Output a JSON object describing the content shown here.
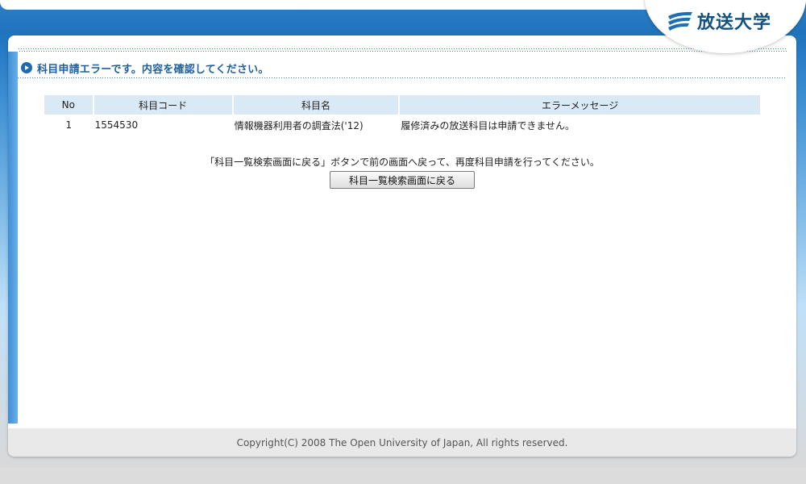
{
  "header": {
    "logo_text": "放送大学",
    "logo_icon": "wave-stripes-icon",
    "brand_color": "#14517f"
  },
  "page": {
    "title": "科目申請エラーです。内容を確認してください。",
    "title_icon": "circle-arrow-right-icon"
  },
  "table": {
    "headers": {
      "no": "No",
      "code": "科目コード",
      "name": "科目名",
      "message": "エラーメッセージ"
    },
    "rows": [
      {
        "no": "1",
        "code": "1554530",
        "name": "情報機器利用者の調査法('12)",
        "message": "履修済みの放送科目は申請できません。"
      }
    ]
  },
  "instruction": "「科目一覧検索画面に戻る」ボタンで前の画面へ戻って、再度科目申請を行ってください。",
  "back_button_label": "科目一覧検索画面に戻る",
  "footer": {
    "copyright": "Copyright(C) 2008 The Open University of Japan, All rights reserved."
  },
  "colors": {
    "header_blue": "#1f73bd",
    "table_header_bg": "#d9e9f6",
    "title_color": "#1d5f9f"
  }
}
